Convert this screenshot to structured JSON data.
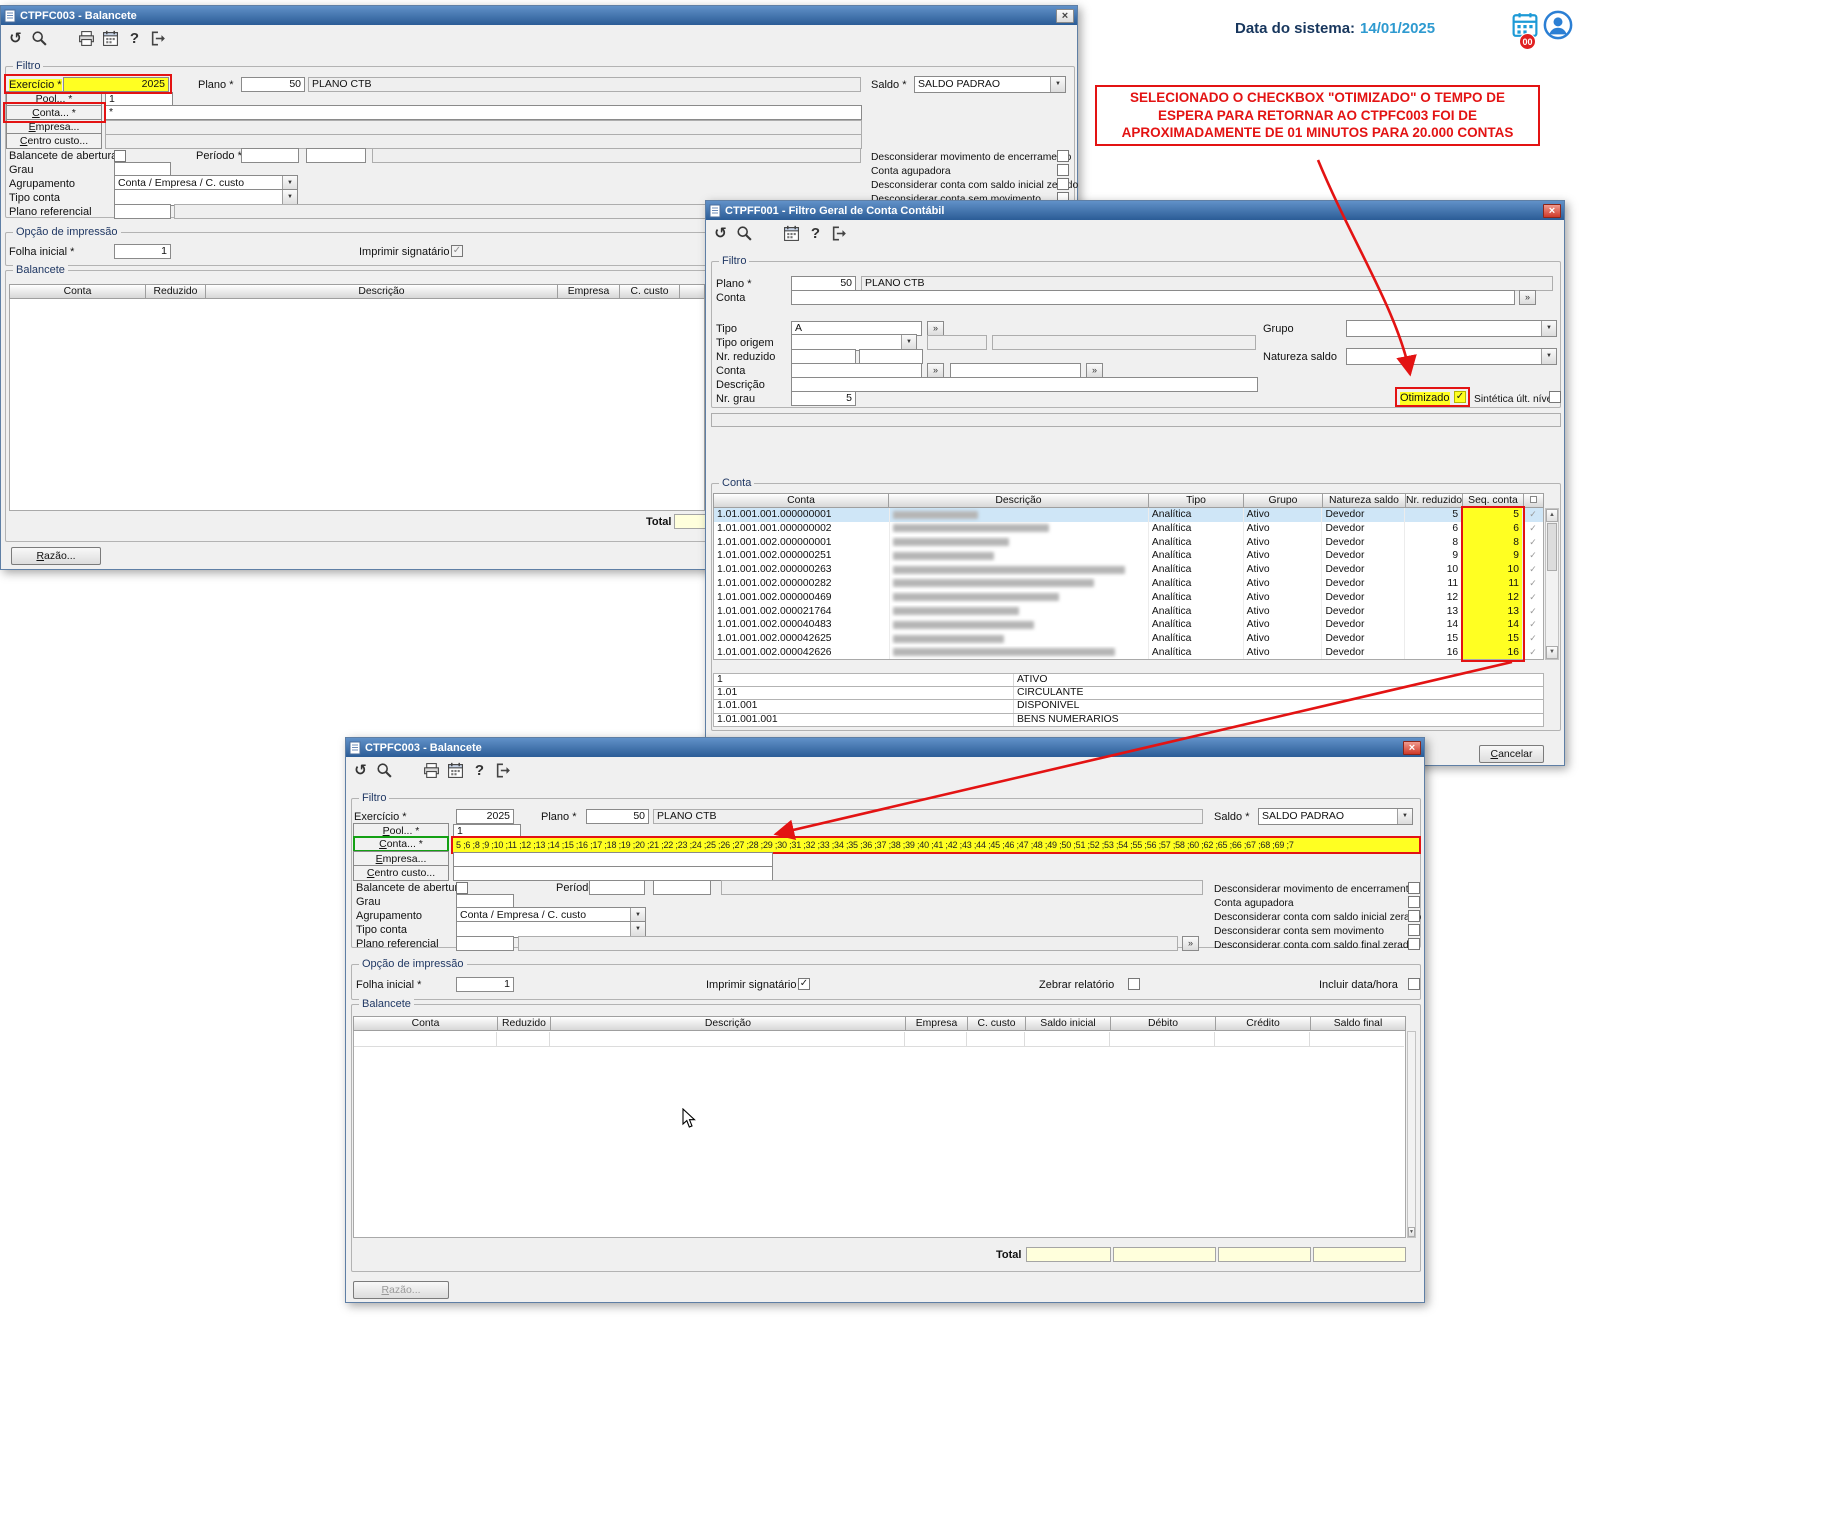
{
  "icons": {
    "undo": "↺",
    "help": "?",
    "close": "×",
    "dropdown": "▼",
    "more": "»",
    "check": "✓",
    "scroll_up": "▲",
    "scroll_down": "▼"
  },
  "system": {
    "date_label": "Data do sistema:",
    "date_value": "14/01/2025",
    "badge": "00"
  },
  "annotation": {
    "line": "SELECIONADO O CHECKBOX \"OTIMIZADO\" O TEMPO DE ESPERA PARA RETORNAR AO CTPFC003 FOI DE APROXIMADAMENTE DE 01 MINUTOS PARA 20.000 CONTAS"
  },
  "win1": {
    "title": "CTPFC003 - Balancete",
    "filtro": {
      "legend": "Filtro",
      "exercicio_label": "Exercício *",
      "exercicio_value": "2025",
      "plano_label": "Plano *",
      "plano_code": "50",
      "plano_name": "PLANO CTB",
      "saldo_label": "Saldo *",
      "saldo_value": "SALDO PADRAO",
      "pool_btn": "Pool... *",
      "pool_value": "1",
      "conta_btn": "Conta... *",
      "conta_value": "*",
      "empresa_btn": "Empresa...",
      "centro_btn": "Centro custo...",
      "balancete_abertura": "Balancete de abertura",
      "periodo_label": "Período *",
      "grau_label": "Grau",
      "agrupamento_label": "Agrupamento",
      "agrupamento_value": "Conta / Empresa / C. custo",
      "tipo_conta_label": "Tipo conta",
      "plano_ref_label": "Plano referencial",
      "chk_encerramento": "Desconsiderar movimento de encerramento",
      "chk_agupadora": "Conta agupadora",
      "chk_saldo_inicial": "Desconsiderar conta com saldo inicial zerado",
      "chk_sem_movimento": "Desconsiderar conta sem movimento"
    },
    "impressao": {
      "legend": "Opção de impressão",
      "folha_label": "Folha inicial *",
      "folha_value": "1",
      "imprimir_label": "Imprimir signatário"
    },
    "balancete": {
      "legend": "Balancete",
      "cols": [
        "Conta",
        "Reduzido",
        "Descrição",
        "Empresa",
        "C. custo"
      ],
      "total_label": "Total"
    },
    "razao_btn": "Razão..."
  },
  "win2": {
    "title": "CTPFF001 - Filtro Geral de Conta Contábil",
    "filtro": {
      "legend": "Filtro",
      "plano_label": "Plano *",
      "plano_code": "50",
      "plano_name": "PLANO CTB",
      "conta_label": "Conta",
      "tipo_label": "Tipo",
      "tipo_value": "A",
      "grupo_label": "Grupo",
      "tipo_origem_label": "Tipo origem",
      "natureza_label": "Natureza saldo",
      "nr_reduzido_label": "Nr. reduzido",
      "conta2_label": "Conta",
      "descricao_label": "Descrição",
      "nr_grau_label": "Nr. grau",
      "nr_grau_value": "5",
      "otimizado_label": "Otimizado",
      "sintetica_label": "Sintética últ. nível"
    },
    "table": {
      "legend": "Conta",
      "cols": [
        "Conta",
        "Descrição",
        "Tipo",
        "Grupo",
        "Natureza saldo",
        "Nr. reduzido",
        "Seq. conta"
      ],
      "rows": [
        {
          "conta": "1.01.001.001.000000001",
          "tipo": "Analítica",
          "grupo": "Ativo",
          "natureza": "Devedor",
          "nr": "5",
          "seq": "5"
        },
        {
          "conta": "1.01.001.001.000000002",
          "tipo": "Analítica",
          "grupo": "Ativo",
          "natureza": "Devedor",
          "nr": "6",
          "seq": "6"
        },
        {
          "conta": "1.01.001.002.000000001",
          "tipo": "Analítica",
          "grupo": "Ativo",
          "natureza": "Devedor",
          "nr": "8",
          "seq": "8"
        },
        {
          "conta": "1.01.001.002.000000251",
          "tipo": "Analítica",
          "grupo": "Ativo",
          "natureza": "Devedor",
          "nr": "9",
          "seq": "9"
        },
        {
          "conta": "1.01.001.002.000000263",
          "tipo": "Analítica",
          "grupo": "Ativo",
          "natureza": "Devedor",
          "nr": "10",
          "seq": "10"
        },
        {
          "conta": "1.01.001.002.000000282",
          "tipo": "Analítica",
          "grupo": "Ativo",
          "natureza": "Devedor",
          "nr": "11",
          "seq": "11"
        },
        {
          "conta": "1.01.001.002.000000469",
          "tipo": "Analítica",
          "grupo": "Ativo",
          "natureza": "Devedor",
          "nr": "12",
          "seq": "12"
        },
        {
          "conta": "1.01.001.002.000021764",
          "tipo": "Analítica",
          "grupo": "Ativo",
          "natureza": "Devedor",
          "nr": "13",
          "seq": "13"
        },
        {
          "conta": "1.01.001.002.000040483",
          "tipo": "Analítica",
          "grupo": "Ativo",
          "natureza": "Devedor",
          "nr": "14",
          "seq": "14"
        },
        {
          "conta": "1.01.001.002.000042625",
          "tipo": "Analítica",
          "grupo": "Ativo",
          "natureza": "Devedor",
          "nr": "15",
          "seq": "15"
        },
        {
          "conta": "1.01.001.002.000042626",
          "tipo": "Analítica",
          "grupo": "Ativo",
          "natureza": "Devedor",
          "nr": "16",
          "seq": "16"
        }
      ]
    },
    "summary": [
      {
        "code": "1",
        "desc": "ATIVO"
      },
      {
        "code": "1.01",
        "desc": "CIRCULANTE"
      },
      {
        "code": "1.01.001",
        "desc": "DISPONIVEL"
      },
      {
        "code": "1.01.001.001",
        "desc": "BENS NUMERARIOS"
      }
    ],
    "cancelar_btn": "Cancelar"
  },
  "win3": {
    "title": "CTPFC003 - Balancete",
    "filtro": {
      "legend": "Filtro",
      "exercicio_label": "Exercício *",
      "exercicio_value": "2025",
      "plano_label": "Plano *",
      "plano_code": "50",
      "plano_name": "PLANO CTB",
      "saldo_label": "Saldo *",
      "saldo_value": "SALDO PADRAO",
      "pool_btn": "Pool... *",
      "pool_value": "1",
      "conta_btn": "Conta... *",
      "conta_value": "5 ;6 ;8 ;9 ;10 ;11 ;12 ;13 ;14 ;15 ;16 ;17 ;18 ;19 ;20 ;21 ;22 ;23 ;24 ;25 ;26 ;27 ;28 ;29 ;30 ;31 ;32 ;33 ;34 ;35 ;36 ;37 ;38 ;39 ;40 ;41 ;42 ;43 ;44 ;45 ;46 ;47 ;48 ;49 ;50 ;51 ;52 ;53 ;54 ;55 ;56 ;57 ;58 ;60 ;62 ;65 ;66 ;67 ;68 ;69 ;7",
      "empresa_btn": "Empresa...",
      "centro_btn": "Centro custo...",
      "balancete_abertura": "Balancete de abertura",
      "periodo_label": "Período *",
      "grau_label": "Grau",
      "agrupamento_label": "Agrupamento",
      "agrupamento_value": "Conta / Empresa / C. custo",
      "tipo_conta_label": "Tipo conta",
      "plano_ref_label": "Plano referencial",
      "chk_encerramento": "Desconsiderar movimento de encerramento",
      "chk_agupadora": "Conta agupadora",
      "chk_saldo_inicial": "Desconsiderar conta com saldo inicial zerado",
      "chk_sem_movimento": "Desconsiderar conta sem movimento",
      "chk_saldo_final": "Desconsiderar conta com saldo final zerado"
    },
    "impressao": {
      "legend": "Opção de impressão",
      "folha_label": "Folha inicial *",
      "folha_value": "1",
      "imprimir_label": "Imprimir signatário",
      "zebrar_label": "Zebrar relatório",
      "incluir_label": "Incluir data/hora"
    },
    "balancete": {
      "legend": "Balancete",
      "cols": [
        "Conta",
        "Reduzido",
        "Descrição",
        "Empresa",
        "C. custo",
        "Saldo inicial",
        "Débito",
        "Crédito",
        "Saldo final"
      ],
      "total_label": "Total"
    },
    "razao_btn": "Razão..."
  }
}
